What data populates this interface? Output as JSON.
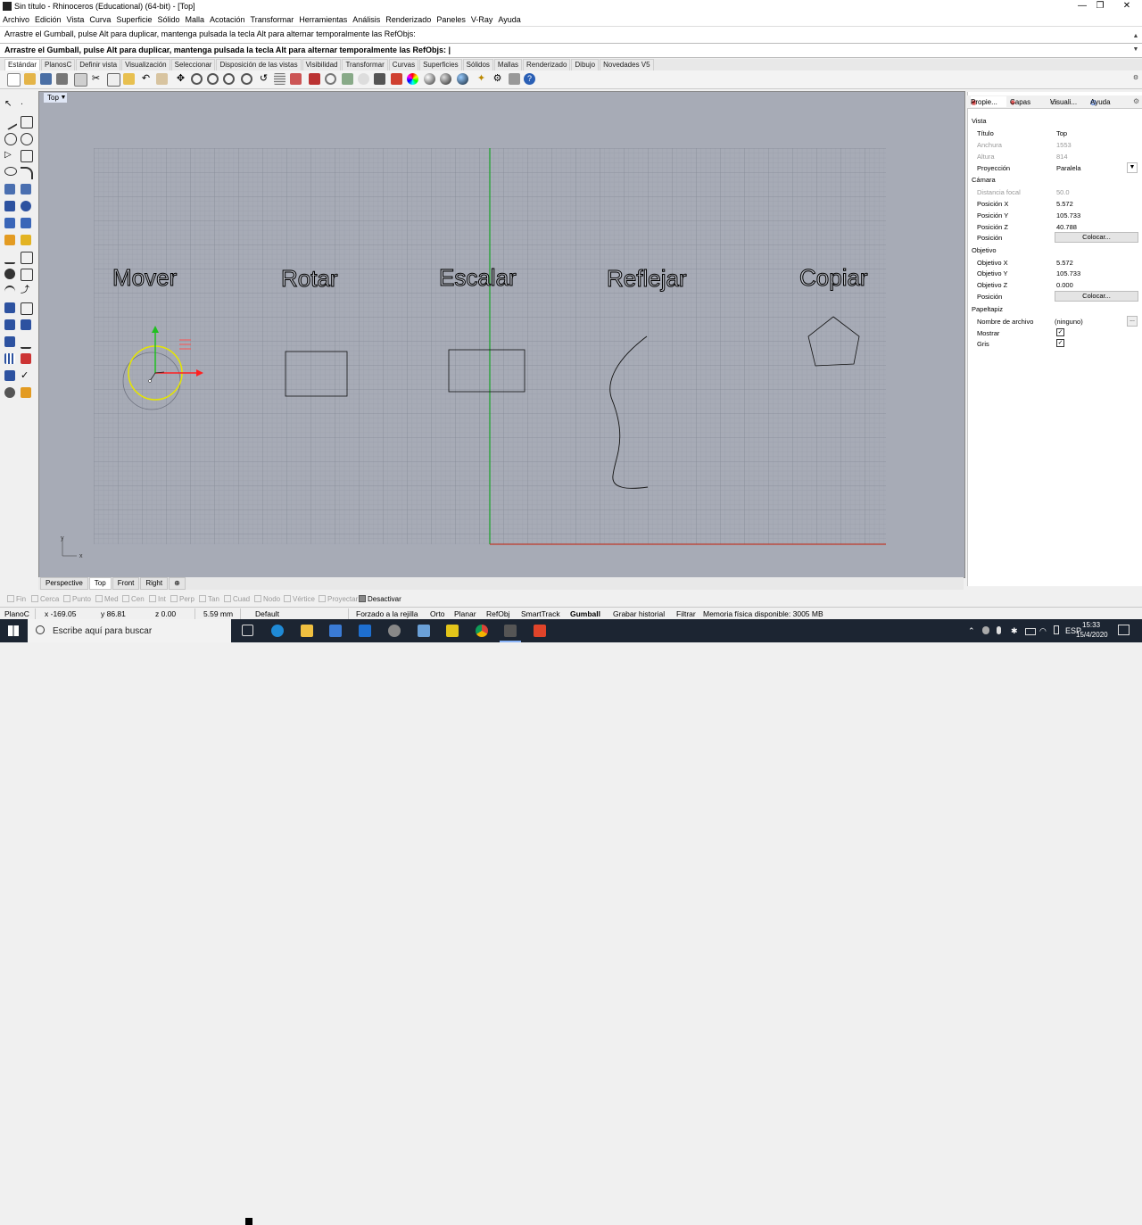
{
  "window": {
    "title": "Sin título - Rhinoceros (Educational) (64-bit) - [Top]",
    "min": "—",
    "max": "❐",
    "close": "✕"
  },
  "menu": [
    "Archivo",
    "Edición",
    "Vista",
    "Curva",
    "Superficie",
    "Sólido",
    "Malla",
    "Acotación",
    "Transformar",
    "Herramientas",
    "Análisis",
    "Renderizado",
    "Paneles",
    "V-Ray",
    "Ayuda"
  ],
  "command": {
    "history": "Arrastre el Gumball, pulse Alt para duplicar, mantenga pulsada la tecla Alt para alternar temporalmente las RefObjs:",
    "prompt": "Arrastre el Gumball, pulse Alt para duplicar, mantenga pulsada la tecla Alt para alternar temporalmente las RefObjs: |"
  },
  "toolbar_tabs": [
    "Estándar",
    "PlanosC",
    "Definir vista",
    "Visualización",
    "Seleccionar",
    "Disposición de las vistas",
    "Visibilidad",
    "Transformar",
    "Curvas",
    "Superficies",
    "Sólidos",
    "Mallas",
    "Renderizado",
    "Dibujo",
    "Novedades V5"
  ],
  "active_toolbar_tab": "Estándar",
  "viewport": {
    "title": "Top",
    "labels": {
      "mover": "Mover",
      "rotar": "Rotar",
      "escalar": "Escalar",
      "reflejar": "Reflejar",
      "copiar": "Copiar"
    },
    "axis_x": "x",
    "axis_y": "y"
  },
  "view_tabs": [
    "Perspective",
    "Top",
    "Front",
    "Right",
    "⊕"
  ],
  "active_view_tab": "Top",
  "panel": {
    "tabs": [
      "Propie...",
      "Capas",
      "Visuali...",
      "Ayuda"
    ],
    "vista": "Vista",
    "titulo_label": "Título",
    "titulo": "Top",
    "anchura_label": "Anchura",
    "anchura": "1553",
    "altura_label": "Altura",
    "altura": "814",
    "proyeccion_label": "Proyección",
    "proyeccion": "Paralela",
    "camara": "Cámara",
    "distancia_label": "Distancia focal",
    "distancia": "50.0",
    "cam_x_label": "Posición X",
    "cam_x": "5.572",
    "cam_y_label": "Posición Y",
    "cam_y": "105.733",
    "cam_z_label": "Posición Z",
    "cam_z": "40.788",
    "cam_pos_label": "Posición",
    "colocar": "Colocar...",
    "objetivo": "Objetivo",
    "obj_x_label": "Objetivo X",
    "obj_x": "5.572",
    "obj_y_label": "Objetivo Y",
    "obj_y": "105.733",
    "obj_z_label": "Objetivo Z",
    "obj_z": "0.000",
    "obj_pos_label": "Posición",
    "papeltapiz": "Papeltapiz",
    "archivo_label": "Nombre de archivo",
    "archivo": "(ninguno)",
    "archivo_btn": "...",
    "mostrar_label": "Mostrar",
    "gris_label": "Gris",
    "check": "✓"
  },
  "osnaps": [
    "Fin",
    "Cerca",
    "Punto",
    "Med",
    "Cen",
    "Int",
    "Perp",
    "Tan",
    "Cuad",
    "Nodo",
    "Vértice",
    "Proyectar",
    "Desactivar"
  ],
  "status": {
    "cplane": "PlanoC",
    "x": "x -169.05",
    "y": "y 86.81",
    "z": "z 0.00",
    "units": "5.59 mm",
    "layer": "Default",
    "snap": "Forzado a la rejilla",
    "ortho": "Orto",
    "planar": "Planar",
    "refobj": "RefObj",
    "smarttrack": "SmartTrack",
    "gumball": "Gumball",
    "history": "Grabar historial",
    "filter": "Filtrar",
    "memory": "Memoria física disponible: 3005 MB"
  },
  "taskbar": {
    "search": "Escribe aquí para buscar",
    "lang": "ESP",
    "time": "15:33",
    "date": "15/4/2020"
  },
  "colors": {
    "x_axis": "#c0392b",
    "y_axis": "#1aa32a",
    "viewport_bg": "#a7abb6",
    "gumball_ring": "#e6e600"
  }
}
